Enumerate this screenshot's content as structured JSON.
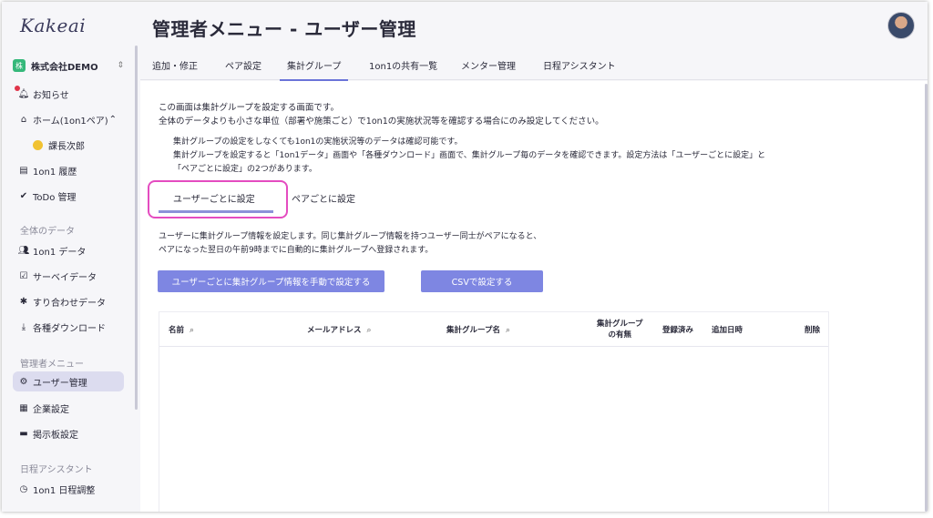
{
  "app": {
    "logo": "Kakeai"
  },
  "sidebar": {
    "company": {
      "badge": "株",
      "name": "株式会社DEMO",
      "switch_icon": "⇕"
    },
    "items": [
      {
        "label": "お知らせ",
        "icon": "bell-icon"
      },
      {
        "label": "ホーム(1on1ペア)",
        "icon": "home-icon",
        "expand": "⌃"
      },
      {
        "label": "課長次郎",
        "icon": "user-icon"
      },
      {
        "label": "1on1 履歴",
        "icon": "history-icon"
      },
      {
        "label": "ToDo 管理",
        "icon": "check-icon"
      }
    ],
    "section_all_data": "全体のデータ",
    "data_items": [
      {
        "label": "1on1 データ",
        "icon": "people-icon"
      },
      {
        "label": "サーベイデータ",
        "icon": "survey-icon"
      },
      {
        "label": "すり合わせデータ",
        "icon": "puzzle-icon"
      },
      {
        "label": "各種ダウンロード",
        "icon": "download-icon"
      }
    ],
    "section_admin": "管理者メニュー",
    "admin_items": [
      {
        "label": "ユーザー管理",
        "icon": "user-manage-icon"
      },
      {
        "label": "企業設定",
        "icon": "company-icon"
      },
      {
        "label": "掲示板設定",
        "icon": "board-icon"
      }
    ],
    "section_schedule": "日程アシスタント",
    "schedule_items": [
      {
        "label": "1on1 日程調整",
        "icon": "clock-icon"
      }
    ]
  },
  "header": {
    "title": "管理者メニュー - ユーザー管理"
  },
  "tabs": [
    {
      "label": "追加・修正"
    },
    {
      "label": "ペア設定"
    },
    {
      "label": "集計グループ"
    },
    {
      "label": "1on1の共有一覧"
    },
    {
      "label": "メンター管理"
    },
    {
      "label": "日程アシスタント"
    }
  ],
  "intro": {
    "line1": "この画面は集計グループを設定する画面です。",
    "line2": "全体のデータよりも小さな単位（部署や施策ごと）で1on1の実施状況等を確認する場合にのみ設定してください。",
    "note1": "集計グループの設定をしなくても1on1の実施状況等のデータは確認可能です。",
    "note2": "集計グループを設定すると「1on1データ」画面や「各種ダウンロード」画面で、集計グループ毎のデータを確認できます。設定方法は「ユーザーごとに設定」と",
    "note3": "「ペアごとに設定」の2つがあります。"
  },
  "subtabs": [
    {
      "label": "ユーザーごとに設定"
    },
    {
      "label": "ペアごとに設定"
    }
  ],
  "description": {
    "line1": "ユーザーに集計グループ情報を設定します。同じ集計グループ情報を持つユーザー同士がペアになると、",
    "line2": "ペアになった翌日の午前9時までに自動的に集計グループへ登録されます。"
  },
  "buttons": {
    "manual": "ユーザーごとに集計グループ情報を手動で設定する",
    "csv": "CSVで設定する"
  },
  "table": {
    "headers": {
      "name": "名前",
      "email": "メールアドレス",
      "group": "集計グループ名",
      "has_group_1": "集計グループ",
      "has_group_2": "の有無",
      "registered": "登録済み",
      "added_at": "追加日時",
      "delete": "削除"
    },
    "rows": []
  },
  "colors": {
    "accent": "#6b74d8",
    "button": "#7e86e2",
    "highlight": "#e44cc0"
  }
}
